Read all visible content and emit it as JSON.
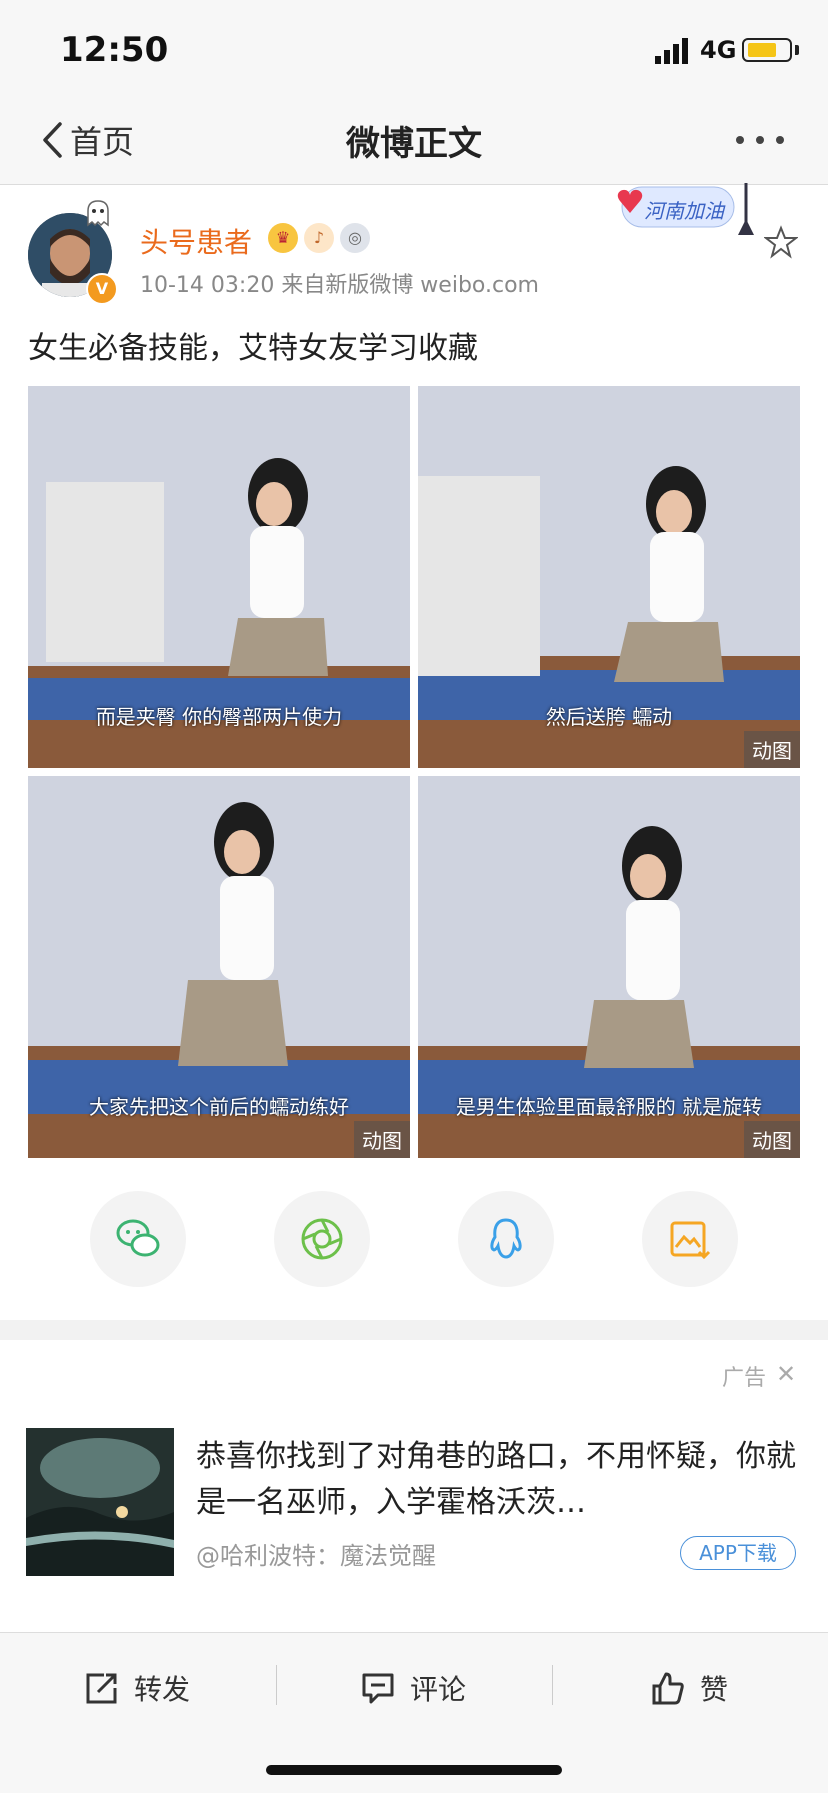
{
  "status_bar": {
    "time": "12:50",
    "network": "4G"
  },
  "nav": {
    "back_label": "首页",
    "title": "微博正文"
  },
  "post": {
    "username": "头号患者",
    "meta": "10-14 03:20  来自新版微博 weibo.com",
    "sticker_text": "河南加油",
    "text": "女生必备技能，艾特女友学习收藏",
    "images": [
      {
        "caption": "而是夹臀 你的臀部两片使力",
        "tag": ""
      },
      {
        "caption": "然后送胯 蠕动",
        "tag": "动图"
      },
      {
        "caption": "大家先把这个前后的蠕动练好",
        "tag": "动图"
      },
      {
        "caption": "是男生体验里面最舒服的 就是旋转",
        "tag": "动图"
      }
    ],
    "verified_badge": "V"
  },
  "share": {
    "icons": [
      "wechat-icon",
      "moments-icon",
      "qq-icon",
      "save-image-icon"
    ],
    "colors": {
      "wechat": "#3cb371",
      "moments": "#6cc04a",
      "qq": "#3aa0e8",
      "save": "#f5a623"
    }
  },
  "ad": {
    "label": "广告",
    "close": "✕",
    "text": "恭喜你找到了对角巷的路口，不用怀疑，你就是一名巫师，入学霍格沃茨…",
    "source": "@哈利波特：魔法觉醒",
    "download": "APP下载"
  },
  "toolbar": {
    "repost": "转发",
    "comment": "评论",
    "like": "赞"
  },
  "colors": {
    "accent_orange": "#ea6a1c",
    "link_blue": "#4a90d9",
    "battery": "#f5c518"
  }
}
